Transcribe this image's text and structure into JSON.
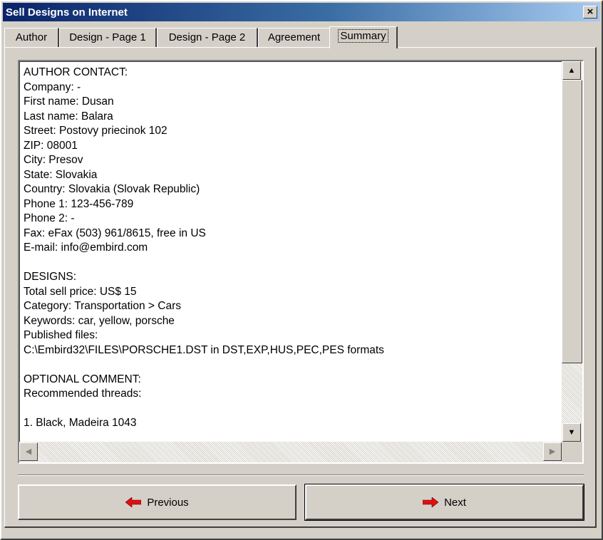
{
  "window": {
    "title": "Sell Designs on Internet",
    "close_symbol": "×"
  },
  "tabs": [
    {
      "label": "Author"
    },
    {
      "label": "Design - Page 1"
    },
    {
      "label": "Design - Page 2"
    },
    {
      "label": "Agreement"
    },
    {
      "label": "Summary"
    }
  ],
  "active_tab": "Summary",
  "summary": {
    "lines": [
      "AUTHOR CONTACT:",
      "Company: -",
      "First name: Dusan",
      "Last name: Balara",
      "Street: Postovy priecinok 102",
      "ZIP: 08001",
      "City: Presov",
      "State: Slovakia",
      "Country: Slovakia (Slovak Republic)",
      "Phone 1: 123-456-789",
      "Phone 2: -",
      "Fax: eFax (503) 961/8615, free in US",
      "E-mail: info@embird.com",
      "",
      "DESIGNS:",
      "Total sell price: US$ 15",
      "Category: Transportation > Cars",
      "Keywords: car, yellow, porsche",
      "Published files:",
      "C:\\Embird32\\FILES\\PORSCHE1.DST in DST,EXP,HUS,PEC,PES formats",
      "",
      "OPTIONAL COMMENT:",
      "Recommended threads:",
      "",
      "1. Black, Madeira 1043"
    ]
  },
  "buttons": {
    "previous_label": "Previous",
    "next_label": "Next"
  },
  "icons": {
    "previous": "red-left-arrow-icon",
    "next": "red-right-arrow-icon",
    "arrow_color": "#e01010"
  }
}
